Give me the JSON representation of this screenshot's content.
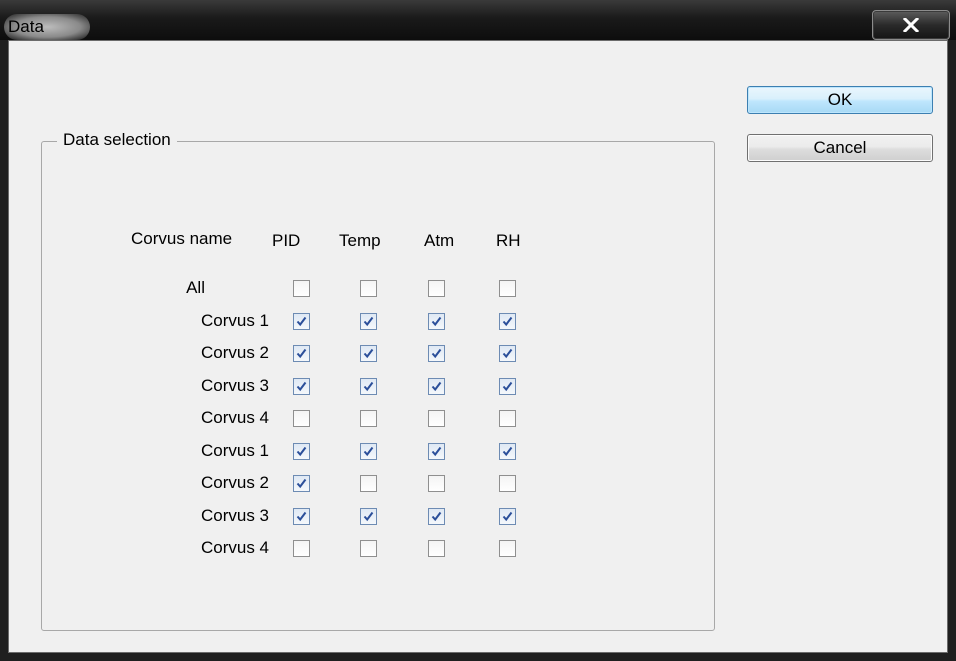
{
  "window": {
    "title": "Data",
    "close_glyph": "x"
  },
  "buttons": {
    "ok": "OK",
    "cancel": "Cancel"
  },
  "group": {
    "title": "Data selection",
    "headers": {
      "name": "Corvus name",
      "col1": "PID",
      "col2": "Temp",
      "col3": "Atm",
      "col4": "RH"
    },
    "rows": [
      {
        "label": "All",
        "checks": [
          false,
          false,
          false,
          false
        ]
      },
      {
        "label": "Corvus 1",
        "checks": [
          true,
          true,
          true,
          true
        ]
      },
      {
        "label": "Corvus 2",
        "checks": [
          true,
          true,
          true,
          true
        ]
      },
      {
        "label": "Corvus 3",
        "checks": [
          true,
          true,
          true,
          true
        ]
      },
      {
        "label": "Corvus 4",
        "checks": [
          false,
          false,
          false,
          false
        ]
      },
      {
        "label": "Corvus 1",
        "checks": [
          true,
          true,
          true,
          true
        ]
      },
      {
        "label": "Corvus 2",
        "checks": [
          true,
          false,
          false,
          false
        ]
      },
      {
        "label": "Corvus 3",
        "checks": [
          true,
          true,
          true,
          true
        ]
      },
      {
        "label": "Corvus 4",
        "checks": [
          false,
          false,
          false,
          false
        ]
      }
    ]
  },
  "colors": {
    "titlebar": "#1a1a1a",
    "client_bg": "#f0f0f0",
    "ok_border": "#3c7fb1",
    "check_mark": "#2b4f9a"
  }
}
